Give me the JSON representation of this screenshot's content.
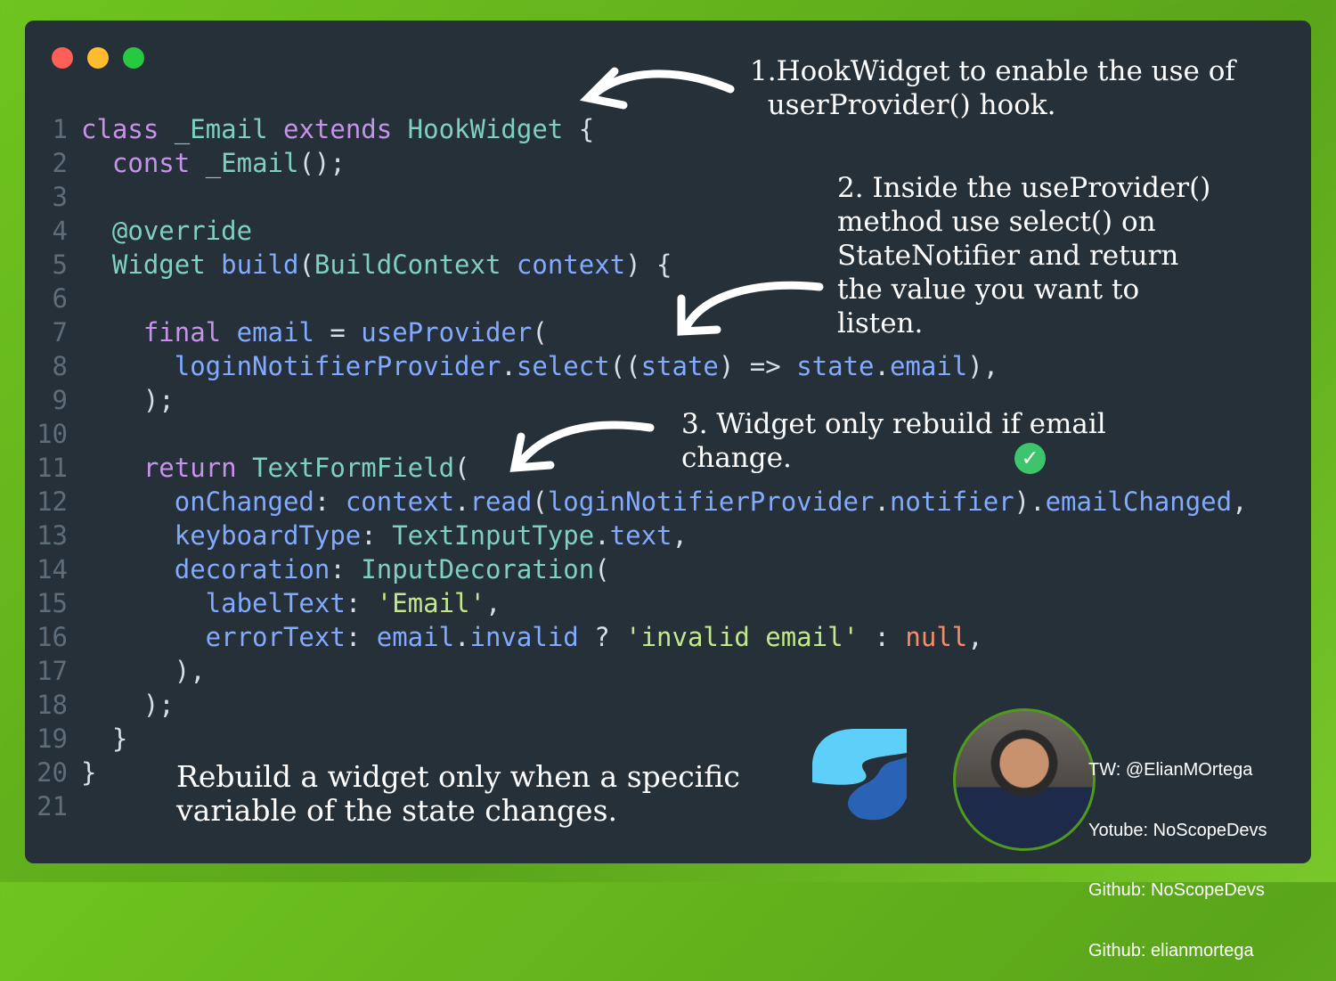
{
  "window_controls": [
    {
      "name": "close",
      "color": "#ff5f57"
    },
    {
      "name": "minimize",
      "color": "#febc2e"
    },
    {
      "name": "maximize",
      "color": "#28c840"
    }
  ],
  "code_lines": [
    [
      [
        "class ",
        "kw"
      ],
      [
        "_Email ",
        "ty"
      ],
      [
        "extends ",
        "kw"
      ],
      [
        "HookWidget ",
        "ty"
      ],
      [
        "{",
        "pl"
      ]
    ],
    [
      [
        "  const ",
        "kw"
      ],
      [
        "_Email",
        "ty"
      ],
      [
        "();",
        "pl"
      ]
    ],
    [],
    [
      [
        "  @override",
        "an"
      ]
    ],
    [
      [
        "  Widget ",
        "ty"
      ],
      [
        "build",
        "fn"
      ],
      [
        "(",
        "pl"
      ],
      [
        "BuildContext ",
        "ty"
      ],
      [
        "context",
        "fn"
      ],
      [
        ") {",
        "pl"
      ]
    ],
    [],
    [
      [
        "    final ",
        "kw"
      ],
      [
        "email ",
        "fn"
      ],
      [
        "= ",
        "pl"
      ],
      [
        "useProvider",
        "fn"
      ],
      [
        "(",
        "pl"
      ]
    ],
    [
      [
        "      loginNotifierProvider",
        "fn"
      ],
      [
        ".",
        "pl"
      ],
      [
        "select",
        "fn"
      ],
      [
        "((",
        "pl"
      ],
      [
        "state",
        "fn"
      ],
      [
        ") => ",
        "pl"
      ],
      [
        "state",
        "fn"
      ],
      [
        ".",
        "pl"
      ],
      [
        "email",
        "fn"
      ],
      [
        "),",
        "pl"
      ]
    ],
    [
      [
        "    );",
        "pl"
      ]
    ],
    [],
    [
      [
        "    return ",
        "kw"
      ],
      [
        "TextFormField",
        "ty"
      ],
      [
        "(",
        "pl"
      ]
    ],
    [
      [
        "      onChanged",
        "fn"
      ],
      [
        ": ",
        "pl"
      ],
      [
        "context",
        "fn"
      ],
      [
        ".",
        "pl"
      ],
      [
        "read",
        "fn"
      ],
      [
        "(",
        "pl"
      ],
      [
        "loginNotifierProvider",
        "fn"
      ],
      [
        ".",
        "pl"
      ],
      [
        "notifier",
        "fn"
      ],
      [
        ").",
        "pl"
      ],
      [
        "emailChanged",
        "fn"
      ],
      [
        ",",
        "pl"
      ]
    ],
    [
      [
        "      keyboardType",
        "fn"
      ],
      [
        ": ",
        "pl"
      ],
      [
        "TextInputType",
        "ty"
      ],
      [
        ".",
        "pl"
      ],
      [
        "text",
        "fn"
      ],
      [
        ",",
        "pl"
      ]
    ],
    [
      [
        "      decoration",
        "fn"
      ],
      [
        ": ",
        "pl"
      ],
      [
        "InputDecoration",
        "ty"
      ],
      [
        "(",
        "pl"
      ]
    ],
    [
      [
        "        labelText",
        "fn"
      ],
      [
        ": ",
        "pl"
      ],
      [
        "'Email'",
        "st"
      ],
      [
        ",",
        "pl"
      ]
    ],
    [
      [
        "        errorText",
        "fn"
      ],
      [
        ": ",
        "pl"
      ],
      [
        "email",
        "fn"
      ],
      [
        ".",
        "pl"
      ],
      [
        "invalid ",
        "fn"
      ],
      [
        "? ",
        "pl"
      ],
      [
        "'invalid email' ",
        "st"
      ],
      [
        ": ",
        "pl"
      ],
      [
        "null",
        "nu"
      ],
      [
        ",",
        "pl"
      ]
    ],
    [
      [
        "      ),",
        "pl"
      ]
    ],
    [
      [
        "    );",
        "pl"
      ]
    ],
    [
      [
        "  }",
        "pl"
      ]
    ],
    [
      [
        "}",
        "pl"
      ]
    ],
    []
  ],
  "annotations": {
    "note1": "1.HookWidget to enable the use of\n  userProvider() hook.",
    "note2": "2. Inside the useProvider()\nmethod use select() on\nStateNotifier and return\nthe value you want to\nlisten.",
    "note3": "3. Widget only rebuild if email\nchange.",
    "caption": "Rebuild a widget only when a specific\nvariable of the state changes."
  },
  "social": {
    "twitter": "TW: @ElianMOrtega",
    "youtube": "Yotube: NoScopeDevs",
    "github1": "Github: NoScopeDevs",
    "github2": "Github: elianmortega"
  },
  "icons": {
    "check": "check-circle-icon",
    "logo": "flutter-hooks-logo",
    "avatar": "author-avatar"
  },
  "colors": {
    "background": "#263038",
    "frame": "#6fc41f",
    "check": "#3ec46d",
    "logo_light": "#5ecff8",
    "logo_dark": "#2a63b6"
  }
}
